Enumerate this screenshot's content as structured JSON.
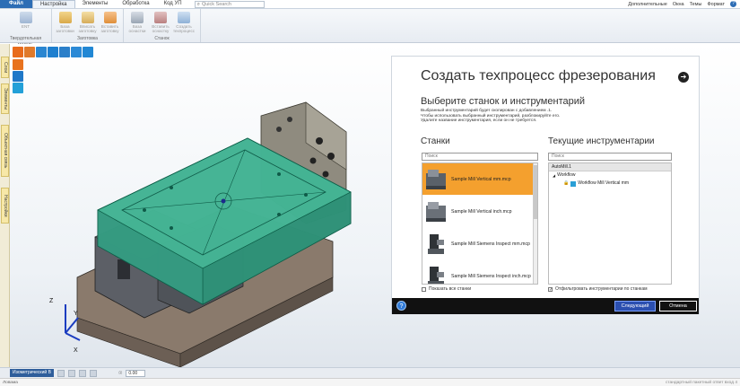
{
  "menu": {
    "tabs": [
      "Файл",
      "Настройка",
      "Элементы",
      "Обработка",
      "Код УП"
    ],
    "search_placeholder": "Quick Search",
    "right": [
      "Дополнительные",
      "Окна",
      "Темы",
      "Формат"
    ]
  },
  "ribbon": {
    "groups": [
      {
        "label": "Твердотельная модель",
        "buttons": [
          "ENT"
        ]
      },
      {
        "label": "Заготовка",
        "buttons": [
          "База заготовки",
          "Вписать заготовку",
          "Вставить заготовку"
        ]
      },
      {
        "label": "Станок",
        "buttons": [
          "База оснастки",
          "Вставить оснастку",
          "Создать техпроцесс"
        ]
      }
    ]
  },
  "side_tabs": [
    "Слои",
    "Элементы",
    "Объектная связь",
    "Настройки"
  ],
  "dialog": {
    "title": "Создать техпроцесс фрезерования",
    "subtitle": "Выберите станок и инструментарий",
    "desc": [
      "Выбранный инструментарий будет скопирован с добавлением .1.",
      "Чтобы использовать выбранный инструментарий, разблокируйте его.",
      "Удалите название инструментария, если он не требуется."
    ],
    "machines_header": "Станки",
    "tooling_header": "Текущие инструментарии",
    "search_placeholder": "Поиск",
    "machines": [
      "Sample Mill Vertical mm.mcp",
      "Sample Mill Vertical inch.mcp",
      "Sample Mill Siemens Inspect mm.mcp",
      "Sample Mill Siemens Inspect inch.mcp"
    ],
    "tooling_head": "AutoMill.1",
    "tooling_tree": [
      "Workflow",
      "Workflow Mill Vertical mm"
    ],
    "show_all_machines": "Показать все станки",
    "filter_tooling": "Отфильтровать инструментарии по станкам",
    "next_button": "Следующий",
    "cancel_button": "Отмена",
    "help_glyph": "?",
    "next_glyph": "➔"
  },
  "status": {
    "view_name": "Изометрический В",
    "zoom": "0.00"
  },
  "footer": {
    "left": "Ловама",
    "right": "стандартный пакетный ответ вход 4"
  },
  "colors": {
    "accent": "#2d6db5",
    "selected_row": "#f4a02e",
    "green_plate": "#3aa58a"
  }
}
